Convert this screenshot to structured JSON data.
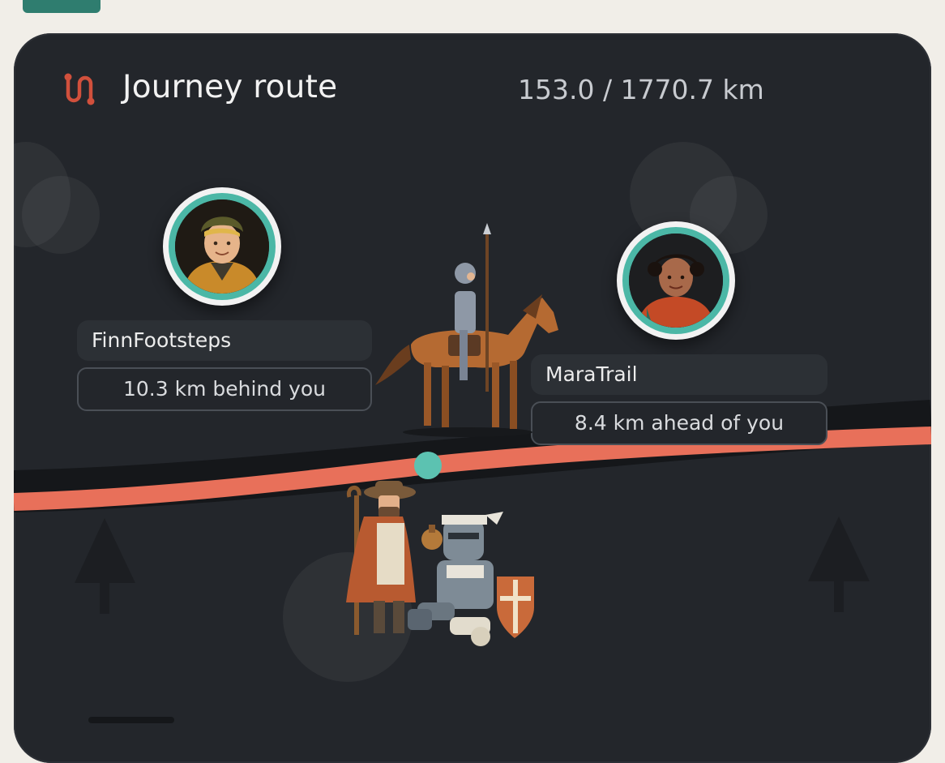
{
  "header": {
    "title": "Journey route",
    "distance_text": "153.0 / 1770.7 km",
    "icon": "route-icon"
  },
  "progress": {
    "current_km": 153.0,
    "total_km": 1770.7
  },
  "route": {
    "line_color": "#e8705a",
    "marker_color": "#5cc2b1"
  },
  "companions": [
    {
      "name": "FinnFootsteps",
      "offset_text": "10.3 km behind you",
      "avatar": "hiker-boy-avatar"
    },
    {
      "name": "MaraTrail",
      "offset_text": "8.4 km ahead of you",
      "avatar": "hiker-girl-avatar"
    }
  ],
  "scene": {
    "sprites": [
      "knight-on-horse-sprite",
      "pilgrim-sprite",
      "resting-knight-sprite"
    ]
  },
  "colors": {
    "accent": "#4bb7a6",
    "route": "#e8705a",
    "background": "#23262b"
  }
}
